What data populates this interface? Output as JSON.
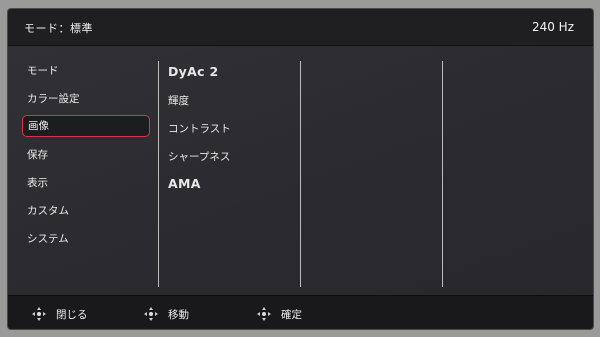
{
  "header": {
    "mode_title": "モード：標準",
    "refresh_rate": "240 Hz"
  },
  "menu": {
    "items": [
      {
        "label": "モード",
        "selected": false
      },
      {
        "label": "カラー設定",
        "selected": false
      },
      {
        "label": "画像",
        "selected": true
      },
      {
        "label": "保存",
        "selected": false
      },
      {
        "label": "表示",
        "selected": false
      },
      {
        "label": "カスタム",
        "selected": false
      },
      {
        "label": "システム",
        "selected": false
      }
    ]
  },
  "submenu": {
    "items": [
      {
        "label": "DyAc 2"
      },
      {
        "label": "輝度"
      },
      {
        "label": "コントラスト"
      },
      {
        "label": "シャープネス"
      },
      {
        "label": "AMA"
      }
    ]
  },
  "footer": {
    "hints": [
      {
        "icon": "dpad-left-icon",
        "label": "閉じる"
      },
      {
        "icon": "dpad-updown-icon",
        "label": "移動"
      },
      {
        "icon": "dpad-right-icon",
        "label": "確定"
      }
    ]
  },
  "colors": {
    "selection_border": "#d8334a",
    "background": "#2d2d31"
  }
}
